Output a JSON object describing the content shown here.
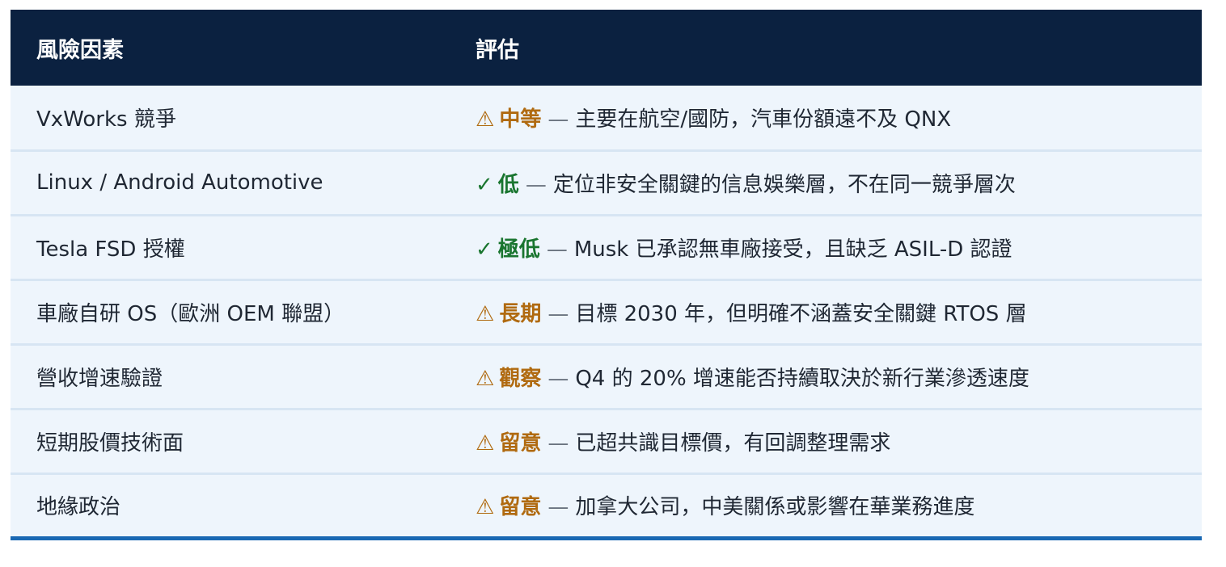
{
  "table": {
    "headers": [
      "風險因素",
      "評估"
    ],
    "dash": "—",
    "rows": [
      {
        "factor": "VxWorks 競爭",
        "icon": "warning-icon",
        "mark": "⚠",
        "level": "中等",
        "tone": "warn",
        "desc": "主要在航空/國防，汽車份額遠不及 QNX"
      },
      {
        "factor": "Linux / Android Automotive",
        "icon": "check-icon",
        "mark": "✓",
        "level": "低",
        "tone": "ok",
        "desc": "定位非安全關鍵的信息娛樂層，不在同一競爭層次"
      },
      {
        "factor": "Tesla FSD 授權",
        "icon": "check-icon",
        "mark": "✓",
        "level": "極低",
        "tone": "ok",
        "desc": "Musk 已承認無車廠接受，且缺乏 ASIL-D 認證"
      },
      {
        "factor": "車廠自研 OS（歐洲 OEM 聯盟）",
        "icon": "warning-icon",
        "mark": "⚠",
        "level": "長期",
        "tone": "warn",
        "desc": "目標 2030 年，但明確不涵蓋安全關鍵 RTOS 層"
      },
      {
        "factor": "營收增速驗證",
        "icon": "warning-icon",
        "mark": "⚠",
        "level": "觀察",
        "tone": "warn",
        "desc": "Q4 的 20% 增速能否持續取決於新行業滲透速度"
      },
      {
        "factor": "短期股價技術面",
        "icon": "warning-icon",
        "mark": "⚠",
        "level": "留意",
        "tone": "warn",
        "desc": "已超共識目標價，有回調整理需求"
      },
      {
        "factor": "地緣政治",
        "icon": "warning-icon",
        "mark": "⚠",
        "level": "留意",
        "tone": "warn",
        "desc": "加拿大公司，中美關係或影響在華業務進度"
      }
    ]
  },
  "colors": {
    "header_bg": "#0b2140",
    "row_bg": "#eef5fc",
    "warn": "#b06a10",
    "ok": "#19752f",
    "bottom_rule": "#1968b3"
  }
}
